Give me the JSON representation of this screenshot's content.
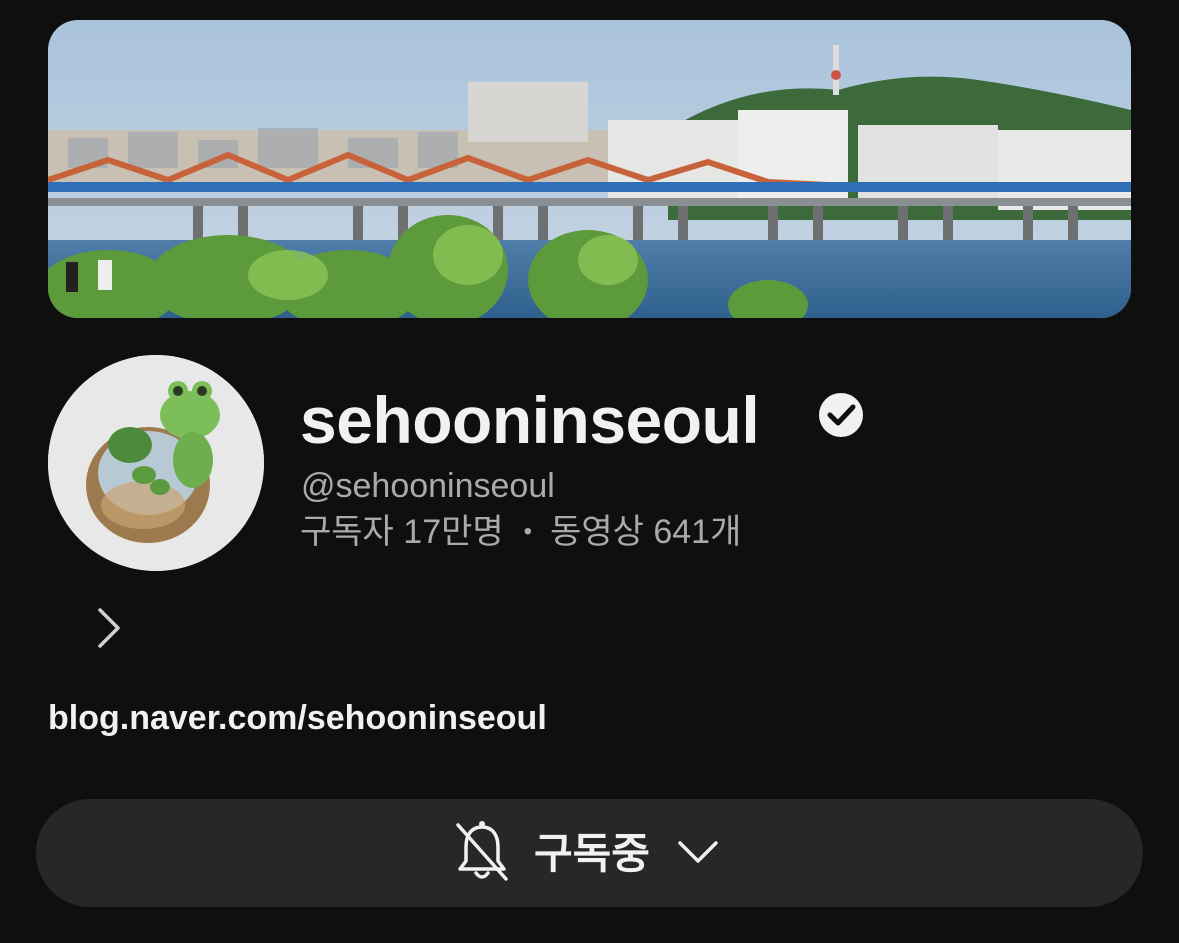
{
  "channel": {
    "name": "sehooninseoul",
    "handle": "@sehooninseoul",
    "subscribers": "구독자 17만명",
    "separator": "•",
    "videos": "동영상 641개",
    "link": "blog.naver.com/sehooninseoul",
    "verified": true
  },
  "subscribe_button": {
    "label": "구독중",
    "icon": "bell-off-icon",
    "dropdown_icon": "chevron-down-icon"
  },
  "icons": {
    "verified": "checkmark-circle-icon",
    "more": "chevron-right-icon"
  },
  "colors": {
    "background": "#0f0f0f",
    "button": "#272727",
    "text_primary": "#f1f1f1",
    "text_secondary": "#aaaaaa"
  }
}
